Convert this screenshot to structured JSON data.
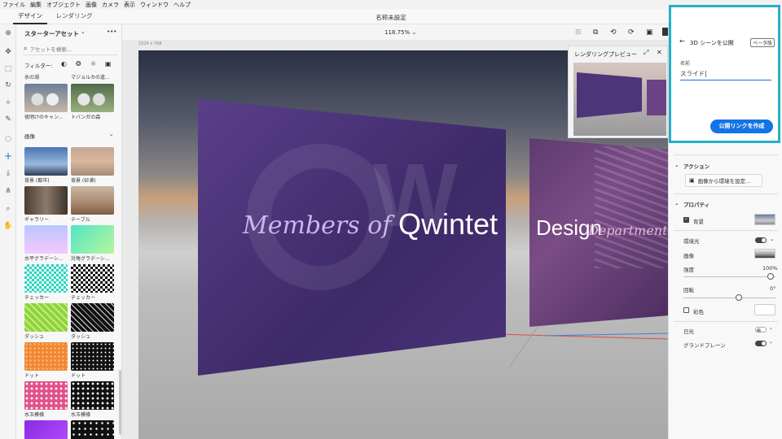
{
  "menubar": {
    "items": [
      "ファイル",
      "編集",
      "オブジェクト",
      "画像",
      "カメラ",
      "表示",
      "ウィンドウ",
      "ヘルプ"
    ]
  },
  "tabs": {
    "design": "デザイン",
    "render": "レンダリング"
  },
  "document": {
    "title": "名称未設定",
    "zoom": "118.75%",
    "canvas_size": "1024 x 768"
  },
  "assets": {
    "title": "スターターアセット",
    "menu": "•••",
    "search_placeholder": "アセットを検索...",
    "filter_label": "フィルター:",
    "env_top_labels": [
      "氷の湖",
      "マジョルカの道..."
    ],
    "env_labels": [
      "夜明けのキャン...",
      "トバンガの森"
    ],
    "images_section": "画像",
    "image_labels": [
      "背景 (都市)",
      "背景 (砂漠)",
      "ギャラリー",
      "テーブル",
      "水平グラデーシ...",
      "対角グラデーシ...",
      "チェッカー",
      "チェッカー",
      "ダッシュ",
      "ダッシュ",
      "ドット",
      "ドット",
      "水玉模様",
      "水玉模様"
    ]
  },
  "render_preview": {
    "title": "レンダリングプレビュー"
  },
  "scene": {
    "panel1_left": "Members of",
    "panel1_right": "Qwintet",
    "panel2_left": "Design",
    "panel2_right": "Department",
    "background_text": "W"
  },
  "publish": {
    "back": "←",
    "title": "3D シーンを公開",
    "badge": "ベータ版",
    "name_label": "名前",
    "name_value": "スライド",
    "button": "公開リンクを作成"
  },
  "actions": {
    "section": "アクション",
    "button": "画像から環境を設定..."
  },
  "properties": {
    "section": "プロパティ",
    "background": "背景",
    "ambient": "環境光",
    "image": "画像",
    "intensity": "強度",
    "intensity_value": "100%",
    "intensity_level": 1.0,
    "rotation": "回転",
    "rotation_value": "0°",
    "rotation_level": 0.5,
    "tint": "彩色",
    "sunlight": "日光",
    "ground_plane": "グランドプレーン"
  },
  "colors": {
    "accent": "#1473e6",
    "highlight": "#24b0c6",
    "panel_purple": "#4a3378"
  }
}
